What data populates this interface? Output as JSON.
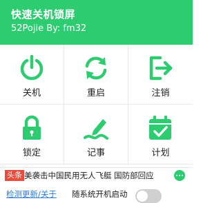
{
  "header": {
    "title": "快速关机锁屏",
    "subtitle": "52Pojie By: fm32"
  },
  "colors": {
    "accent": "#2ecc71",
    "news_tag": "#e74c3c",
    "link": "#2d7bd6"
  },
  "actions": [
    {
      "label": "关机",
      "icon": "power-icon"
    },
    {
      "label": "重启",
      "icon": "refresh-icon"
    },
    {
      "label": "注销",
      "icon": "logout-icon"
    },
    {
      "label": "锁定",
      "icon": "lock-icon"
    },
    {
      "label": "记事",
      "icon": "pen-icon"
    },
    {
      "label": "计划",
      "icon": "calendar-check-icon"
    }
  ],
  "news": {
    "tag": "头条",
    "text": "美袭击中国民用无人飞艇 国防部回应",
    "more_icon": "more-dots-icon"
  },
  "footer": {
    "update_link": "检测更新/关于",
    "autostart_label": "随系统开机启动",
    "autostart_on": false
  }
}
